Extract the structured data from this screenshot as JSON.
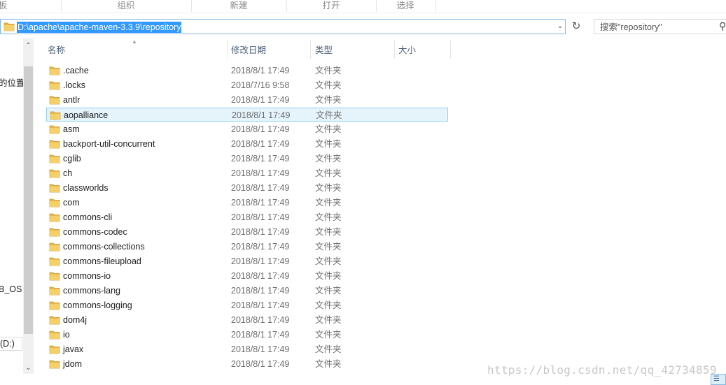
{
  "ribbon": {
    "tabs": [
      {
        "label": "板"
      },
      {
        "label": "组织"
      },
      {
        "label": "新建"
      },
      {
        "label": "打开"
      },
      {
        "label": "选择"
      }
    ]
  },
  "address_bar": {
    "path": "D:\\apache\\apache-maven-3.3.9\\repository"
  },
  "search": {
    "placeholder": "搜索\"repository\""
  },
  "nav_pane": {
    "partial_labels": [
      "的位置",
      "B_OS (",
      "(D:)"
    ]
  },
  "columns": {
    "name": "名称",
    "modified": "修改日期",
    "type": "类型",
    "size": "大小"
  },
  "files": [
    {
      "name": ".cache",
      "modified": "2018/8/1 17:49",
      "type": "文件夹"
    },
    {
      "name": ".locks",
      "modified": "2018/7/16 9:58",
      "type": "文件夹"
    },
    {
      "name": "antlr",
      "modified": "2018/8/1 17:49",
      "type": "文件夹"
    },
    {
      "name": "aopalliance",
      "modified": "2018/8/1 17:49",
      "type": "文件夹",
      "selected": true
    },
    {
      "name": "asm",
      "modified": "2018/8/1 17:49",
      "type": "文件夹"
    },
    {
      "name": "backport-util-concurrent",
      "modified": "2018/8/1 17:49",
      "type": "文件夹"
    },
    {
      "name": "cglib",
      "modified": "2018/8/1 17:49",
      "type": "文件夹"
    },
    {
      "name": "ch",
      "modified": "2018/8/1 17:49",
      "type": "文件夹"
    },
    {
      "name": "classworlds",
      "modified": "2018/8/1 17:49",
      "type": "文件夹"
    },
    {
      "name": "com",
      "modified": "2018/8/1 17:49",
      "type": "文件夹"
    },
    {
      "name": "commons-cli",
      "modified": "2018/8/1 17:49",
      "type": "文件夹"
    },
    {
      "name": "commons-codec",
      "modified": "2018/8/1 17:49",
      "type": "文件夹"
    },
    {
      "name": "commons-collections",
      "modified": "2018/8/1 17:49",
      "type": "文件夹"
    },
    {
      "name": "commons-fileupload",
      "modified": "2018/8/1 17:49",
      "type": "文件夹"
    },
    {
      "name": "commons-io",
      "modified": "2018/8/1 17:49",
      "type": "文件夹"
    },
    {
      "name": "commons-lang",
      "modified": "2018/8/1 17:49",
      "type": "文件夹"
    },
    {
      "name": "commons-logging",
      "modified": "2018/8/1 17:49",
      "type": "文件夹"
    },
    {
      "name": "dom4j",
      "modified": "2018/8/1 17:49",
      "type": "文件夹"
    },
    {
      "name": "io",
      "modified": "2018/8/1 17:49",
      "type": "文件夹"
    },
    {
      "name": "javax",
      "modified": "2018/8/1 17:49",
      "type": "文件夹"
    },
    {
      "name": "jdom",
      "modified": "2018/8/1 17:49",
      "type": "文件夹"
    }
  ],
  "watermark": "https://blog.csdn.net/qq_42734859",
  "colors": {
    "folder": "#e8b94a",
    "selection_bg": "#e5f3fb",
    "selection_border": "#99d1f5",
    "address_highlight": "#3399ff"
  }
}
